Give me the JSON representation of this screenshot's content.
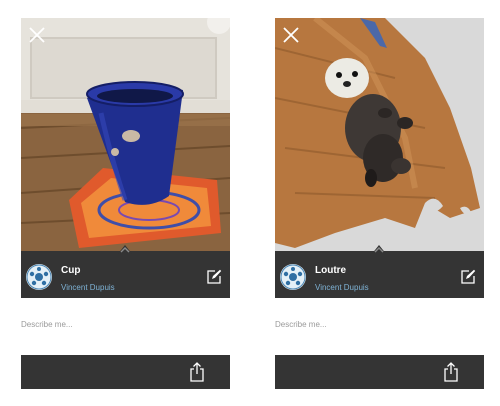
{
  "cards": [
    {
      "title": "Cup",
      "author": "Vincent Dupuis",
      "description_placeholder": "Describe me...",
      "icons": {
        "close": "close-icon",
        "edit": "edit-icon",
        "share": "share-icon",
        "expand": "chevron-up-icon"
      }
    },
    {
      "title": "Loutre",
      "author": "Vincent Dupuis",
      "description_placeholder": "Describe me...",
      "icons": {
        "close": "close-icon",
        "edit": "edit-icon",
        "share": "share-icon",
        "expand": "chevron-up-icon"
      }
    }
  ],
  "colors": {
    "bar_background": "#343434",
    "title_text": "#ffffff",
    "author_text": "#7fb3d6",
    "placeholder_text": "#9a9a9a"
  }
}
